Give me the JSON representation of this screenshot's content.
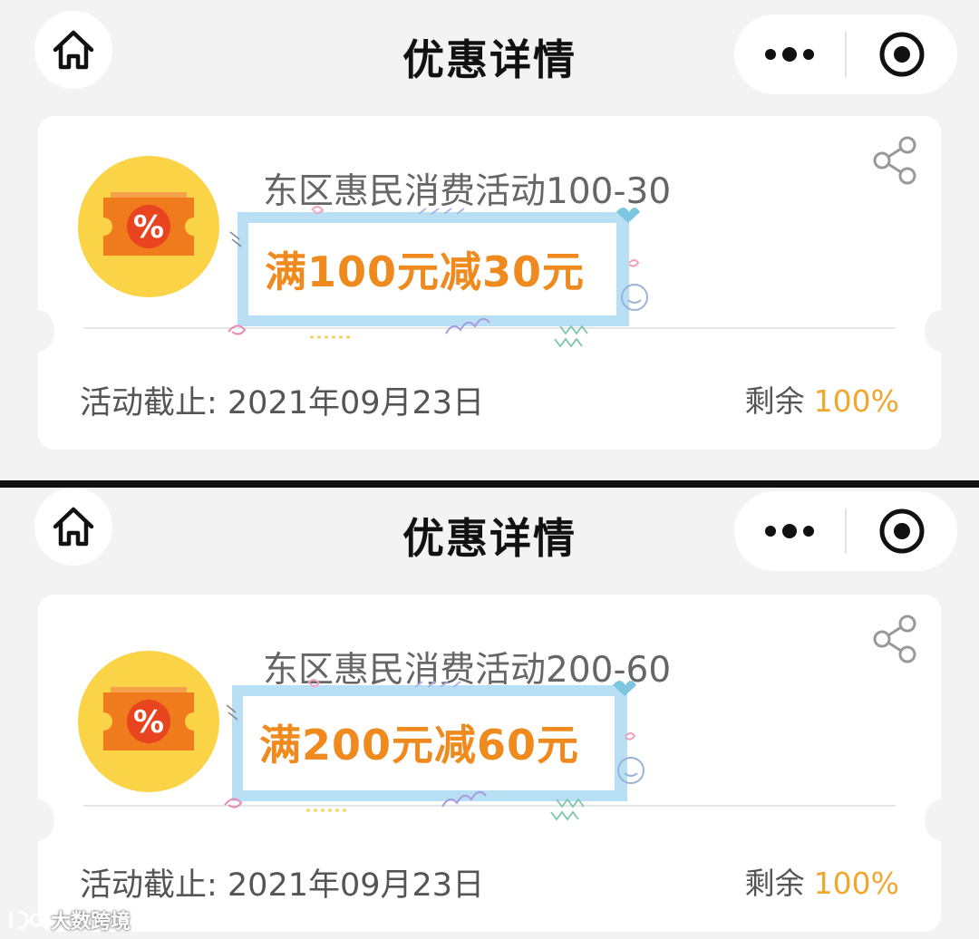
{
  "panels": [
    {
      "nav": {
        "title": "优惠详情",
        "home_icon": "home-icon",
        "more_icon": "more-dots-icon",
        "close_icon": "close-circle-icon"
      },
      "coupon": {
        "event_title": "东区惠民消费活动100-30",
        "deal": "满100元减30元",
        "deadline": "活动截止: 2021年09月23日",
        "remain_label": "剩余",
        "remain_value": "100%",
        "share_icon": "share-icon",
        "logo_icon": "coupon-percent-icon"
      }
    },
    {
      "nav": {
        "title": "优惠详情",
        "home_icon": "home-icon",
        "more_icon": "more-dots-icon",
        "close_icon": "close-circle-icon"
      },
      "coupon": {
        "event_title": "东区惠民消费活动200-60",
        "deal": "满200元减60元",
        "deadline": "活动截止: 2021年09月23日",
        "remain_label": "剩余",
        "remain_value": "100%",
        "share_icon": "share-icon",
        "logo_icon": "coupon-percent-icon"
      }
    }
  ],
  "watermark": {
    "text": "大数跨境"
  },
  "colors": {
    "accent_orange": "#ef8a1e",
    "remain_orange": "#f0a72e",
    "frame_blue": "#b8dff3",
    "logo_yellow": "#fbd347",
    "ticket_orange": "#f07b1c"
  }
}
